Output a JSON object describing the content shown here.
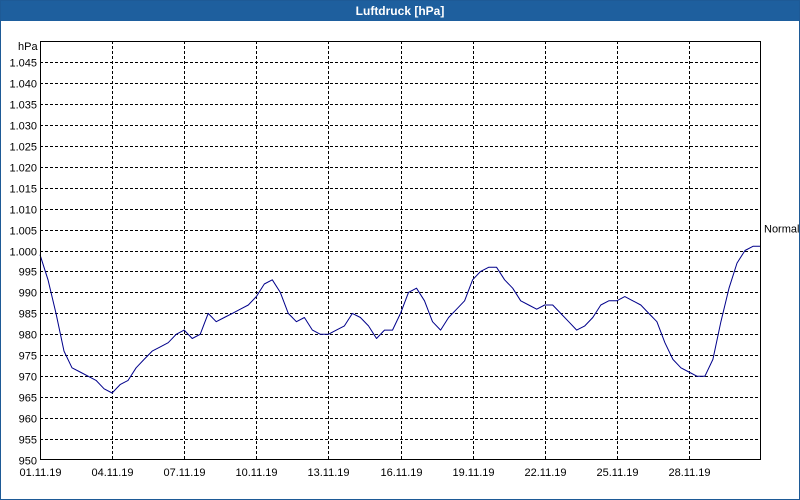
{
  "window": {
    "title": "Luftdruck [hPa]"
  },
  "chart_data": {
    "type": "line",
    "title": "Luftdruck [hPa]",
    "ylabel": "hPa",
    "xlabel": "",
    "ylim": [
      950,
      1050
    ],
    "yticks": [
      {
        "value": 950,
        "label": "950"
      },
      {
        "value": 955,
        "label": "955"
      },
      {
        "value": 960,
        "label": "960"
      },
      {
        "value": 965,
        "label": "965"
      },
      {
        "value": 970,
        "label": "970"
      },
      {
        "value": 975,
        "label": "975"
      },
      {
        "value": 980,
        "label": "980"
      },
      {
        "value": 985,
        "label": "985"
      },
      {
        "value": 990,
        "label": "990"
      },
      {
        "value": 995,
        "label": "995"
      },
      {
        "value": 1000,
        "label": "1.000"
      },
      {
        "value": 1005,
        "label": "1.005"
      },
      {
        "value": 1010,
        "label": "1.010"
      },
      {
        "value": 1015,
        "label": "1.015"
      },
      {
        "value": 1020,
        "label": "1.020"
      },
      {
        "value": 1025,
        "label": "1.025"
      },
      {
        "value": 1030,
        "label": "1.030"
      },
      {
        "value": 1035,
        "label": "1.035"
      },
      {
        "value": 1040,
        "label": "1.040"
      },
      {
        "value": 1045,
        "label": "1.045"
      }
    ],
    "xlim": [
      "01.11.19",
      "01.12.19"
    ],
    "xticks": [
      {
        "value": "01.11.19",
        "label": "01.11.19"
      },
      {
        "value": "04.11.19",
        "label": "04.11.19"
      },
      {
        "value": "07.11.19",
        "label": "07.11.19"
      },
      {
        "value": "10.11.19",
        "label": "10.11.19"
      },
      {
        "value": "13.11.19",
        "label": "13.11.19"
      },
      {
        "value": "16.11.19",
        "label": "16.11.19"
      },
      {
        "value": "19.11.19",
        "label": "19.11.19"
      },
      {
        "value": "22.11.19",
        "label": "22.11.19"
      },
      {
        "value": "25.11.19",
        "label": "25.11.19"
      },
      {
        "value": "28.11.19",
        "label": "28.11.19"
      }
    ],
    "grid": true,
    "series": [
      {
        "color": "#00008b",
        "end_label": "Normal",
        "points": [
          [
            "01.11.19 00:00",
            999
          ],
          [
            "01.11.19 08:00",
            993
          ],
          [
            "01.11.19 16:00",
            985
          ],
          [
            "02.11.19 00:00",
            976
          ],
          [
            "02.11.19 08:00",
            972
          ],
          [
            "02.11.19 16:00",
            971
          ],
          [
            "03.11.19 00:00",
            970
          ],
          [
            "03.11.19 08:00",
            969
          ],
          [
            "03.11.19 16:00",
            967
          ],
          [
            "04.11.19 00:00",
            966
          ],
          [
            "04.11.19 08:00",
            968
          ],
          [
            "04.11.19 16:00",
            969
          ],
          [
            "05.11.19 00:00",
            972
          ],
          [
            "05.11.19 08:00",
            974
          ],
          [
            "05.11.19 16:00",
            976
          ],
          [
            "06.11.19 00:00",
            977
          ],
          [
            "06.11.19 08:00",
            978
          ],
          [
            "06.11.19 16:00",
            980
          ],
          [
            "07.11.19 00:00",
            981
          ],
          [
            "07.11.19 08:00",
            979
          ],
          [
            "07.11.19 16:00",
            980
          ],
          [
            "08.11.19 00:00",
            985
          ],
          [
            "08.11.19 08:00",
            983
          ],
          [
            "08.11.19 16:00",
            984
          ],
          [
            "09.11.19 00:00",
            985
          ],
          [
            "09.11.19 08:00",
            986
          ],
          [
            "09.11.19 16:00",
            987
          ],
          [
            "10.11.19 00:00",
            989
          ],
          [
            "10.11.19 08:00",
            992
          ],
          [
            "10.11.19 16:00",
            993
          ],
          [
            "11.11.19 00:00",
            990
          ],
          [
            "11.11.19 08:00",
            985
          ],
          [
            "11.11.19 16:00",
            983
          ],
          [
            "12.11.19 00:00",
            984
          ],
          [
            "12.11.19 08:00",
            981
          ],
          [
            "12.11.19 16:00",
            980
          ],
          [
            "13.11.19 00:00",
            980
          ],
          [
            "13.11.19 08:00",
            981
          ],
          [
            "13.11.19 16:00",
            982
          ],
          [
            "14.11.19 00:00",
            985
          ],
          [
            "14.11.19 08:00",
            984
          ],
          [
            "14.11.19 16:00",
            982
          ],
          [
            "15.11.19 00:00",
            979
          ],
          [
            "15.11.19 08:00",
            981
          ],
          [
            "15.11.19 16:00",
            981
          ],
          [
            "16.11.19 00:00",
            985
          ],
          [
            "16.11.19 08:00",
            990
          ],
          [
            "16.11.19 16:00",
            991
          ],
          [
            "17.11.19 00:00",
            988
          ],
          [
            "17.11.19 08:00",
            983
          ],
          [
            "17.11.19 16:00",
            981
          ],
          [
            "18.11.19 00:00",
            984
          ],
          [
            "18.11.19 08:00",
            986
          ],
          [
            "18.11.19 16:00",
            988
          ],
          [
            "19.11.19 00:00",
            993
          ],
          [
            "19.11.19 08:00",
            995
          ],
          [
            "19.11.19 16:00",
            996
          ],
          [
            "20.11.19 00:00",
            996
          ],
          [
            "20.11.19 08:00",
            993
          ],
          [
            "20.11.19 16:00",
            991
          ],
          [
            "21.11.19 00:00",
            988
          ],
          [
            "21.11.19 08:00",
            987
          ],
          [
            "21.11.19 16:00",
            986
          ],
          [
            "22.11.19 00:00",
            987
          ],
          [
            "22.11.19 08:00",
            987
          ],
          [
            "22.11.19 16:00",
            985
          ],
          [
            "23.11.19 00:00",
            983
          ],
          [
            "23.11.19 08:00",
            981
          ],
          [
            "23.11.19 16:00",
            982
          ],
          [
            "24.11.19 00:00",
            984
          ],
          [
            "24.11.19 08:00",
            987
          ],
          [
            "24.11.19 16:00",
            988
          ],
          [
            "25.11.19 00:00",
            988
          ],
          [
            "25.11.19 08:00",
            989
          ],
          [
            "25.11.19 16:00",
            988
          ],
          [
            "26.11.19 00:00",
            987
          ],
          [
            "26.11.19 08:00",
            985
          ],
          [
            "26.11.19 16:00",
            983
          ],
          [
            "27.11.19 00:00",
            978
          ],
          [
            "27.11.19 08:00",
            974
          ],
          [
            "27.11.19 16:00",
            972
          ],
          [
            "28.11.19 00:00",
            971
          ],
          [
            "28.11.19 08:00",
            970
          ],
          [
            "28.11.19 16:00",
            970
          ],
          [
            "29.11.19 00:00",
            974
          ],
          [
            "29.11.19 08:00",
            983
          ],
          [
            "29.11.19 16:00",
            991
          ],
          [
            "30.11.19 00:00",
            997
          ],
          [
            "30.11.19 08:00",
            1000
          ],
          [
            "30.11.19 16:00",
            1001
          ],
          [
            "01.12.19 00:00",
            1001
          ]
        ]
      }
    ]
  }
}
